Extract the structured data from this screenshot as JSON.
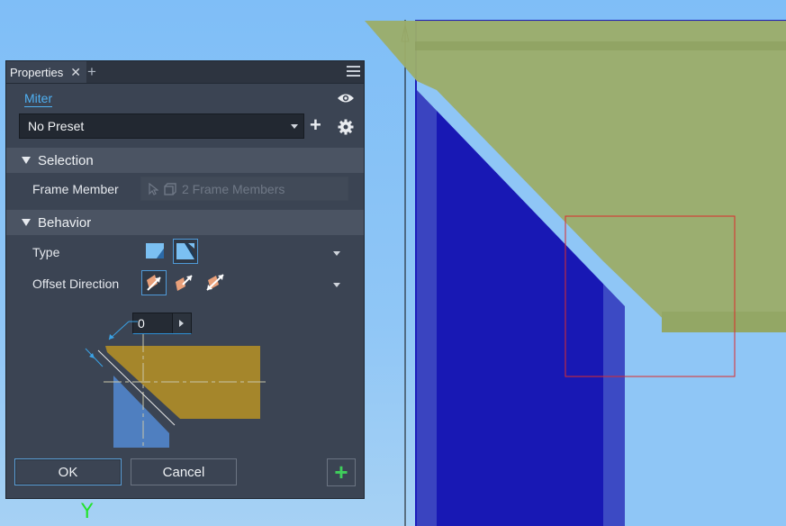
{
  "panel": {
    "tab_label": "Properties",
    "tab_close": "✕",
    "tab_add": "+",
    "command_name": "Miter",
    "preset": {
      "value": "No Preset"
    },
    "add_label": "+",
    "sections": {
      "selection": {
        "title": "Selection",
        "frame_member_label": "Frame Member",
        "frame_member_value": "2 Frame Members"
      },
      "behavior": {
        "title": "Behavior",
        "type_label": "Type",
        "offset_direction_label": "Offset Direction",
        "offset_value": "0"
      }
    },
    "buttons": {
      "ok": "OK",
      "cancel": "Cancel",
      "apply_add": "+"
    }
  },
  "viewport": {
    "axis_label": "Y"
  },
  "colors": {
    "accent": "#4fb0f2",
    "panel_bg": "#3b4453",
    "beam_blue": "#1818b4",
    "beam_olive": "#9bad6a",
    "add_green": "#3fcf5b"
  }
}
